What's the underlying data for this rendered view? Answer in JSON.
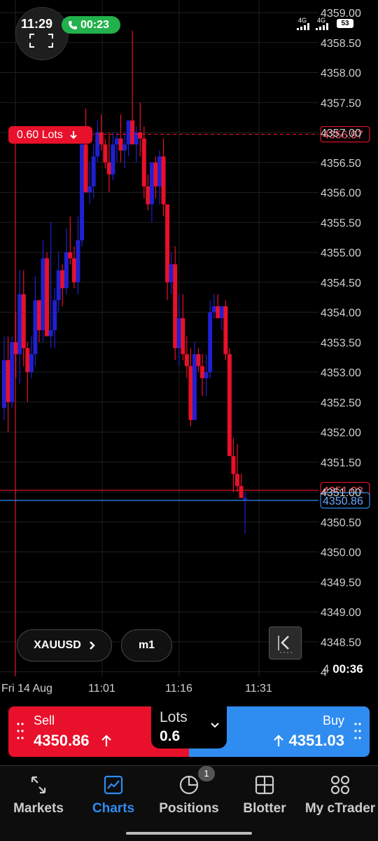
{
  "status_bar": {
    "time": "11:29",
    "call_duration": "00:23",
    "network_1": "4G",
    "network_2": "4G",
    "battery": "53"
  },
  "chart_data": {
    "type": "candlestick",
    "symbol": "XAUUSD",
    "timeframe": "m1",
    "ylim": [
      4348.0,
      4359.0
    ],
    "y_ticks": [
      "4359.00",
      "4358.50",
      "4358.00",
      "4357.50",
      "4357.00",
      "4356.50",
      "4356.00",
      "4355.50",
      "4355.00",
      "4354.50",
      "4354.00",
      "4353.50",
      "4353.00",
      "4352.50",
      "4352.00",
      "4351.50",
      "4351.00",
      "4350.50",
      "4350.00",
      "4349.50",
      "4349.00",
      "4348.50",
      "4"
    ],
    "x_ticks": [
      {
        "label": "Fri 14 Aug",
        "index": 0
      },
      {
        "label": "11:01",
        "index": 26
      },
      {
        "label": "11:16",
        "index": 46
      },
      {
        "label": "11:31",
        "index": 65
      }
    ],
    "colors": {
      "up": "#2020d0",
      "down": "#e8102a",
      "grid": "#1f1f1f",
      "tick_text": "#d0d0d0"
    },
    "candles": [
      [
        4352.4,
        4353.6,
        4352.2,
        4353.2
      ],
      [
        4353.2,
        4353.6,
        4352.0,
        4352.5
      ],
      [
        4352.5,
        4353.6,
        4352.4,
        4353.5
      ],
      [
        4353.5,
        4354.0,
        4352.9,
        4353.3
      ],
      [
        4353.3,
        4354.7,
        4352.8,
        4354.3
      ],
      [
        4354.3,
        4354.7,
        4353.1,
        4353.4
      ],
      [
        4353.4,
        4353.5,
        4352.5,
        4353.0
      ],
      [
        4353.0,
        4353.6,
        4352.9,
        4353.3
      ],
      [
        4353.3,
        4354.6,
        4353.1,
        4354.2
      ],
      [
        4354.2,
        4354.2,
        4353.5,
        4353.7
      ],
      [
        4353.7,
        4355.2,
        4353.5,
        4354.9
      ],
      [
        4354.9,
        4355.0,
        4353.6,
        4353.6
      ],
      [
        4353.6,
        4355.5,
        4353.4,
        4353.7
      ],
      [
        4353.7,
        4354.4,
        4353.4,
        4354.2
      ],
      [
        4354.2,
        4355.0,
        4354.0,
        4354.7
      ],
      [
        4354.7,
        4354.8,
        4354.1,
        4354.4
      ],
      [
        4354.4,
        4355.4,
        4354.3,
        4355.0
      ],
      [
        4355.0,
        4355.6,
        4354.8,
        4354.9
      ],
      [
        4354.9,
        4355.1,
        4354.4,
        4354.5
      ],
      [
        4354.5,
        4355.6,
        4354.3,
        4355.2
      ],
      [
        4355.2,
        4356.9,
        4355.1,
        4356.8
      ],
      [
        4356.8,
        4357.4,
        4356.2,
        4356.0
      ],
      [
        4356.0,
        4356.5,
        4355.8,
        4356.1
      ],
      [
        4356.1,
        4356.8,
        4355.9,
        4356.6
      ],
      [
        4356.6,
        4357.2,
        4356.5,
        4357.0
      ],
      [
        4357.0,
        4357.3,
        4356.7,
        4356.8
      ],
      [
        4356.8,
        4356.9,
        4356.4,
        4356.5
      ],
      [
        4356.5,
        4357.0,
        4356.0,
        4356.3
      ],
      [
        4356.3,
        4357.0,
        4356.2,
        4356.8
      ],
      [
        4356.8,
        4357.0,
        4356.5,
        4356.9
      ],
      [
        4356.9,
        4357.3,
        4356.5,
        4356.7
      ],
      [
        4356.7,
        4357.0,
        4356.4,
        4356.8
      ],
      [
        4356.8,
        4357.2,
        4356.6,
        4357.2
      ],
      [
        4357.2,
        4358.7,
        4356.8,
        4356.8
      ],
      [
        4356.8,
        4357.1,
        4356.5,
        4357.0
      ],
      [
        4357.0,
        4357.5,
        4356.6,
        4356.9
      ],
      [
        4356.9,
        4357.1,
        4355.9,
        4356.1
      ],
      [
        4356.1,
        4356.3,
        4355.7,
        4355.8
      ],
      [
        4355.8,
        4356.5,
        4355.5,
        4356.5
      ],
      [
        4356.5,
        4356.6,
        4355.9,
        4356.1
      ],
      [
        4356.1,
        4356.7,
        4355.8,
        4356.6
      ],
      [
        4356.6,
        4356.9,
        4355.6,
        4355.8
      ],
      [
        4355.8,
        4355.8,
        4354.2,
        4354.5
      ],
      [
        4354.5,
        4355.0,
        4354.3,
        4354.8
      ],
      [
        4354.8,
        4355.1,
        4353.2,
        4353.4
      ],
      [
        4353.4,
        4354.3,
        4353.1,
        4353.9
      ],
      [
        4353.9,
        4354.3,
        4353.2,
        4353.3
      ],
      [
        4353.3,
        4353.6,
        4352.9,
        4353.1
      ],
      [
        4353.1,
        4353.4,
        4352.1,
        4352.2
      ],
      [
        4352.2,
        4353.5,
        4352.2,
        4353.3
      ],
      [
        4353.3,
        4353.4,
        4353.0,
        4353.1
      ],
      [
        4353.1,
        4353.3,
        4352.6,
        4352.9
      ],
      [
        4352.9,
        4353.3,
        4352.6,
        4353.0
      ],
      [
        4353.0,
        4354.2,
        4352.9,
        4354.0
      ],
      [
        4354.0,
        4354.3,
        4353.9,
        4354.1
      ],
      [
        4354.1,
        4354.3,
        4353.9,
        4353.9
      ],
      [
        4353.9,
        4354.1,
        4353.7,
        4354.1
      ],
      [
        4354.1,
        4354.2,
        4353.2,
        4353.3
      ],
      [
        4353.3,
        4353.4,
        4351.6,
        4351.6
      ],
      [
        4351.6,
        4351.9,
        4351.0,
        4351.3
      ],
      [
        4351.3,
        4351.8,
        4351.0,
        4351.1
      ],
      [
        4351.1,
        4351.3,
        4350.9,
        4350.9
      ],
      [
        4350.9,
        4351.0,
        4350.3,
        4350.9
      ]
    ],
    "candle_index_offset": 0,
    "horizontal_lines": [
      {
        "name": "position-line",
        "price": 4356.97,
        "label": "4356.97",
        "color": "#e8102a",
        "style": "dashed"
      },
      {
        "name": "ask-line",
        "price": 4351.03,
        "label": "4351.03",
        "color": "#e8102a",
        "style": "solid"
      },
      {
        "name": "bid-line",
        "price": 4350.86,
        "label": "4350.86",
        "color": "#2f8cf0",
        "style": "solid"
      }
    ]
  },
  "position_tag": {
    "label": "0.60 Lots"
  },
  "chart_controls": {
    "symbol": "XAUUSD",
    "timeframe": "m1",
    "countdown_prefix": "4",
    "countdown": "00:36"
  },
  "trade_panel": {
    "sell_label": "Sell",
    "sell_price": "4350.86",
    "buy_label": "Buy",
    "buy_price": "4351.03",
    "lots_label": "Lots",
    "lots_value": "0.6"
  },
  "nav": {
    "items": [
      {
        "label": "Markets",
        "icon": "markets-icon"
      },
      {
        "label": "Charts",
        "icon": "charts-icon"
      },
      {
        "label": "Positions",
        "icon": "positions-icon",
        "badge": "1"
      },
      {
        "label": "Blotter",
        "icon": "blotter-icon"
      },
      {
        "label": "My cTrader",
        "icon": "grid-icon"
      }
    ],
    "active": "Charts"
  }
}
